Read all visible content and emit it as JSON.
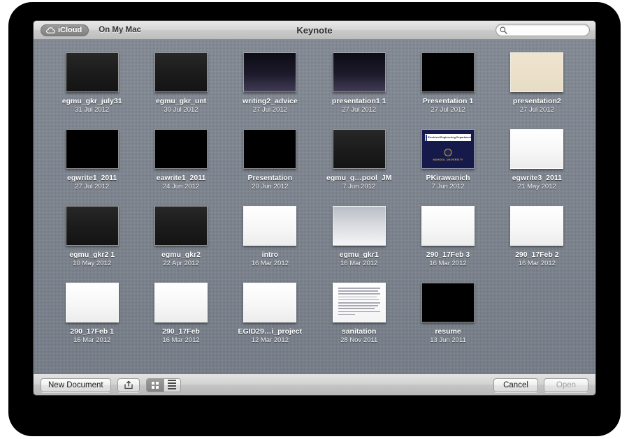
{
  "titlebar": {
    "icloud_label": "iCloud",
    "icloud_icon": "cloud-icon",
    "onmymac_label": "On My Mac",
    "window_title": "Keynote",
    "search_icon": "search-icon",
    "search_value": "",
    "search_placeholder": ""
  },
  "documents": [
    {
      "name": "egmu_gkr_july31",
      "date": "31 Jul 2012",
      "style": "t-darkgray"
    },
    {
      "name": "egmu_gkr_unt",
      "date": "30 Jul 2012",
      "style": "t-darkgray"
    },
    {
      "name": "writing2_advice",
      "date": "27 Jul 2012",
      "style": "t-darkpurple"
    },
    {
      "name": "presentation1 1",
      "date": "27 Jul 2012",
      "style": "t-darkpurple"
    },
    {
      "name": "Presentation 1",
      "date": "27 Jul 2012",
      "style": "t-black"
    },
    {
      "name": "presentation2",
      "date": "27 Jul 2012",
      "style": "t-beige"
    },
    {
      "name": "egwrite1_2011",
      "date": "27 Jul 2012",
      "style": "t-black"
    },
    {
      "name": "eawrite1_2011",
      "date": "24 Jun 2012",
      "style": "t-black"
    },
    {
      "name": "Presentation",
      "date": "20 Jun 2012",
      "style": "t-black"
    },
    {
      "name": "egmu_g…pool_JM",
      "date": "7 Jun 2012",
      "style": "t-darkgray"
    },
    {
      "name": "PKirawanich",
      "date": "7 Jun 2012",
      "style": "t-navy",
      "slide": {
        "header_text": "Electrical Engineering Department",
        "university_text": "MAHIDOL UNIVERSITY"
      }
    },
    {
      "name": "egwrite3_2011",
      "date": "21 May 2012",
      "style": "t-white"
    },
    {
      "name": "egmu_gkr2 1",
      "date": "10 May 2012",
      "style": "t-darkgray"
    },
    {
      "name": "egmu_gkr2",
      "date": "22 Apr 2012",
      "style": "t-darkgray"
    },
    {
      "name": "intro",
      "date": "16 Mar 2012",
      "style": "t-white"
    },
    {
      "name": "egmu_gkr1",
      "date": "16 Mar 2012",
      "style": "t-graygrad"
    },
    {
      "name": "290_17Feb 3",
      "date": "16 Mar 2012",
      "style": "t-white"
    },
    {
      "name": "290_17Feb 2",
      "date": "16 Mar 2012",
      "style": "t-white"
    },
    {
      "name": "290_17Feb 1",
      "date": "16 Mar 2012",
      "style": "t-white"
    },
    {
      "name": "290_17Feb",
      "date": "16 Mar 2012",
      "style": "t-white"
    },
    {
      "name": "EGID29…i_project",
      "date": "12 Mar 2012",
      "style": "t-white"
    },
    {
      "name": "sanitation",
      "date": "28 Nov 2011",
      "style": "t-letter"
    },
    {
      "name": "resume",
      "date": "13 Jun 2011",
      "style": "t-black"
    }
  ],
  "bottombar": {
    "new_document_label": "New Document",
    "share_icon": "share-icon",
    "grid_view_icon": "grid-view-icon",
    "list_view_icon": "list-view-icon",
    "cancel_label": "Cancel",
    "open_label": "Open"
  },
  "colors": {
    "background": "#7c838e",
    "titlebar": "#d6d6d6",
    "text_light": "#ffffff"
  }
}
